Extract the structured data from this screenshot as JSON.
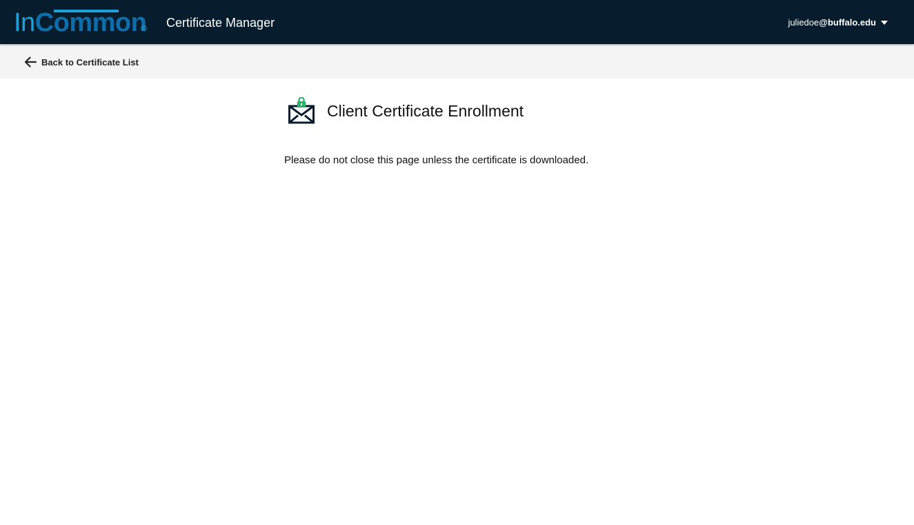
{
  "header": {
    "logo": {
      "in": "In",
      "common": "Common",
      "reg": "®"
    },
    "app_title": "Certificate Manager",
    "user": {
      "name": "juliedoe",
      "domain": "@buffalo.edu"
    }
  },
  "subnav": {
    "back_label": "Back to Certificate List"
  },
  "main": {
    "title": "Client Certificate Enrollment",
    "notice": "Please do not close this page unless the certificate is downloaded."
  },
  "icons": {
    "back": "arrow-left-icon",
    "user_menu": "caret-down-icon",
    "enrollment": "secure-envelope-icon"
  },
  "colors": {
    "topbar": "#071c2c",
    "subbar": "#f4f4f4",
    "logo_light": "#1ea0d8",
    "logo_dark": "#0e6eaa",
    "lock_green": "#25b36a",
    "text": "#111111"
  }
}
